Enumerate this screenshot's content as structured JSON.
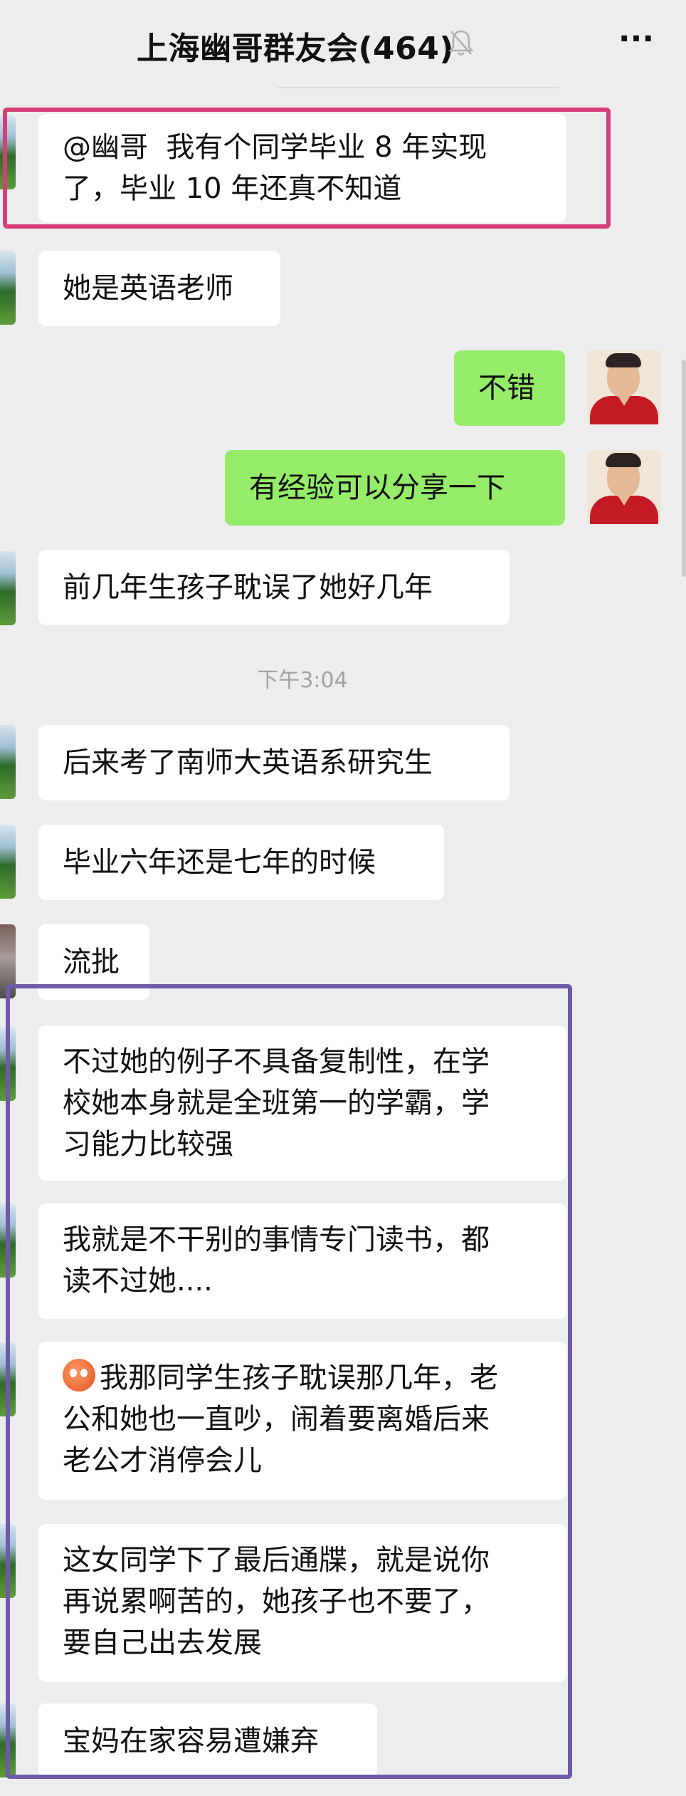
{
  "header": {
    "title": "上海幽哥群友会(464)",
    "mute_icon": "bell-slash-icon",
    "more_label": "···"
  },
  "time_divider": "下午3:04",
  "messages": [
    {
      "id": "m1",
      "side": "left",
      "text": "@幽哥  我有个同学毕业 8 年实现\n了，毕业 10 年还真不知道"
    },
    {
      "id": "m2",
      "side": "left",
      "text": "她是英语老师"
    },
    {
      "id": "m3",
      "side": "right",
      "text": "不错"
    },
    {
      "id": "m4",
      "side": "right",
      "text": "有经验可以分享一下"
    },
    {
      "id": "m5",
      "side": "left",
      "text": "前几年生孩子耽误了她好几年"
    },
    {
      "id": "m6",
      "side": "left",
      "text": "后来考了南师大英语系研究生"
    },
    {
      "id": "m7",
      "side": "left",
      "text": "毕业六年还是七年的时候"
    },
    {
      "id": "m8",
      "side": "left",
      "text": "流批"
    },
    {
      "id": "m9",
      "side": "left",
      "text": "不过她的例子不具备复制性，在学\n校她本身就是全班第一的学霸，学\n习能力比较强"
    },
    {
      "id": "m10",
      "side": "left",
      "text": "我就是不干别的事情专门读书，都\n读不过她...."
    },
    {
      "id": "m11",
      "side": "left",
      "emoji": "sad-face-emoji",
      "text": "我那同学生孩子耽误那几年，老\n公和她也一直吵，闹着要离婚后来\n老公才消停会儿"
    },
    {
      "id": "m12",
      "side": "left",
      "text": "这女同学下了最后通牒，就是说你\n再说累啊苦的，她孩子也不要了，\n要自己出去发展"
    },
    {
      "id": "m13",
      "side": "left",
      "text": "宝妈在家容易遭嫌弃"
    }
  ],
  "highlight_colors": {
    "pink_frame": "#d63e7a",
    "purple_frame": "#6e5aa8",
    "green_bubble": "#95ec69"
  }
}
